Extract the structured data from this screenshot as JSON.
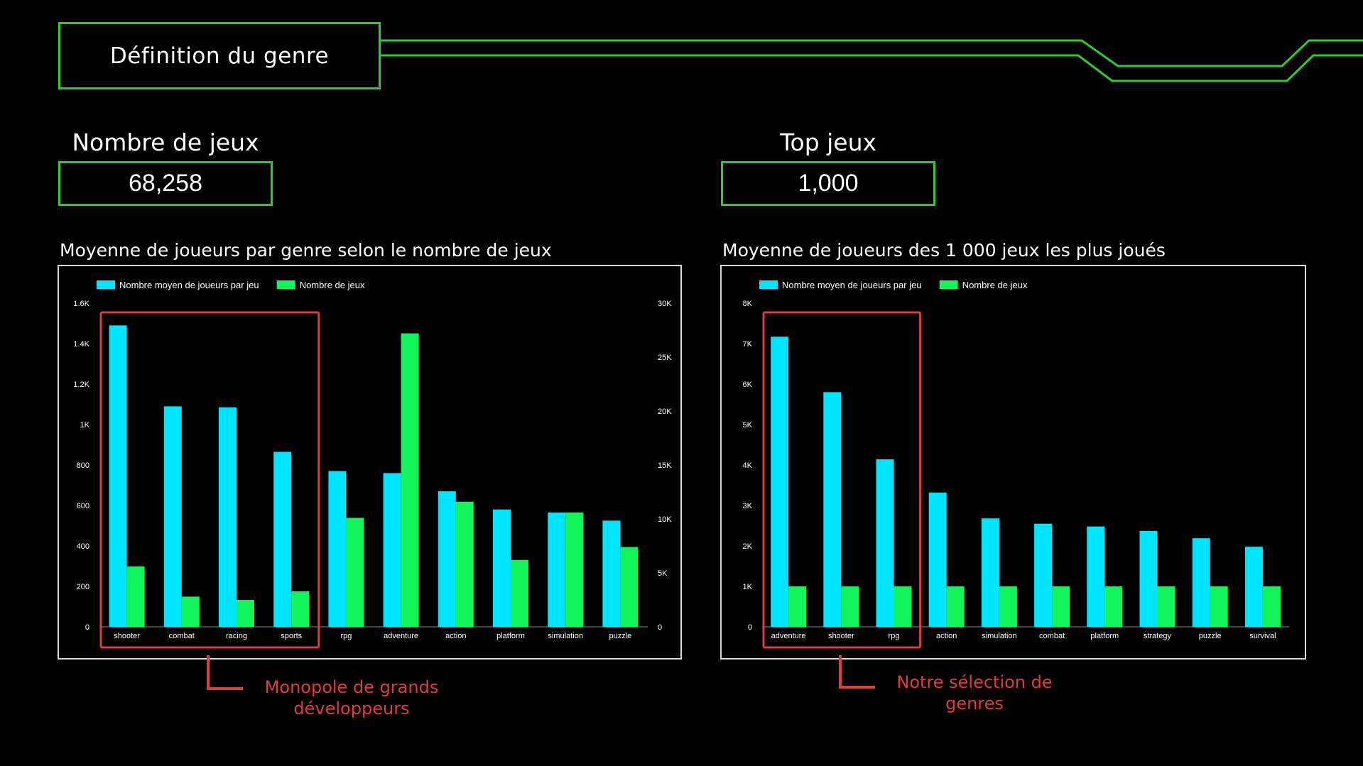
{
  "page": {
    "title": "Définition du genre",
    "colors": {
      "accent_green": "#2ecc2e",
      "annotation_red": "#e03c3c",
      "series_cyan": "#00e5ff",
      "series_green": "#11f55a"
    }
  },
  "kpis": [
    {
      "label": "Nombre de jeux",
      "value": "68,258"
    },
    {
      "label": "Top jeux",
      "value": "1,000"
    }
  ],
  "annotations": [
    {
      "text_line1": "Monopole de grands",
      "text_line2": "développeurs"
    },
    {
      "text_line1": "Notre sélection de",
      "text_line2": "genres"
    }
  ],
  "chart_data": [
    {
      "type": "bar",
      "title": "Moyenne de joueurs par genre selon le nombre de jeux",
      "categories": [
        "shooter",
        "combat",
        "racing",
        "sports",
        "rpg",
        "adventure",
        "action",
        "platform",
        "simulation",
        "puzzle"
      ],
      "series": [
        {
          "name": "Nombre moyen de joueurs par jeu",
          "axis": "left",
          "color": "#00e5ff",
          "values": [
            1490,
            1090,
            1085,
            865,
            770,
            760,
            670,
            580,
            565,
            525
          ]
        },
        {
          "name": "Nombre de jeux",
          "axis": "right",
          "color": "#11f55a",
          "values": [
            5600,
            2800,
            2500,
            3300,
            10100,
            27200,
            11600,
            6200,
            10600,
            7400
          ]
        }
      ],
      "y_left": {
        "ylim": [
          0,
          1600
        ],
        "ticks": [
          "0",
          "200",
          "400",
          "600",
          "800",
          "1K",
          "1.2K",
          "1.4K",
          "1.6K"
        ],
        "tick_values": [
          0,
          200,
          400,
          600,
          800,
          1000,
          1200,
          1400,
          1600
        ]
      },
      "y_right": {
        "ylim": [
          0,
          30000
        ],
        "ticks": [
          "0",
          "5K",
          "10K",
          "15K",
          "20K",
          "25K",
          "30K"
        ],
        "tick_values": [
          0,
          5000,
          10000,
          15000,
          20000,
          25000,
          30000
        ]
      },
      "highlight": {
        "categories": [
          "shooter",
          "combat",
          "racing",
          "sports"
        ]
      },
      "legend": "top-left",
      "grid": false
    },
    {
      "type": "bar",
      "title": "Moyenne de joueurs des 1 000 jeux les plus joués",
      "categories": [
        "adventure",
        "shooter",
        "rpg",
        "action",
        "simulation",
        "combat",
        "platform",
        "strategy",
        "puzzle",
        "survival"
      ],
      "series": [
        {
          "name": "Nombre moyen de joueurs par jeu",
          "axis": "left",
          "color": "#00e5ff",
          "values": [
            7170,
            5800,
            4140,
            3320,
            2680,
            2550,
            2480,
            2370,
            2190,
            1980
          ]
        },
        {
          "name": "Nombre de jeux",
          "axis": "left",
          "color": "#11f55a",
          "values": [
            1000,
            1000,
            1000,
            1000,
            1000,
            1000,
            1000,
            1000,
            1000,
            1000
          ]
        }
      ],
      "y_left": {
        "ylim": [
          0,
          8000
        ],
        "ticks": [
          "0",
          "1K",
          "2K",
          "3K",
          "4K",
          "5K",
          "6K",
          "7K",
          "8K"
        ],
        "tick_values": [
          0,
          1000,
          2000,
          3000,
          4000,
          5000,
          6000,
          7000,
          8000
        ]
      },
      "highlight": {
        "categories": [
          "adventure",
          "shooter",
          "rpg"
        ]
      },
      "legend": "top-left",
      "grid": false
    }
  ]
}
